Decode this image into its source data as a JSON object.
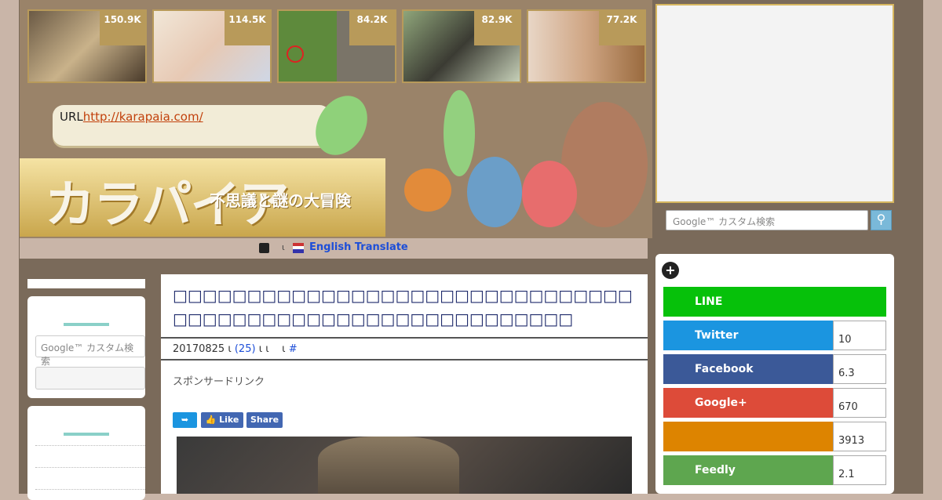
{
  "thumbs": [
    {
      "count": "150.9K",
      "name": "oysters"
    },
    {
      "count": "114.5K",
      "name": "snow-white-drawing"
    },
    {
      "count": "84.2K",
      "name": "grave"
    },
    {
      "count": "82.9K",
      "name": "cat-tree"
    },
    {
      "count": "77.2K",
      "name": "woman-tiger"
    }
  ],
  "url": {
    "label": "URL",
    "link": "http://karapaia.com/"
  },
  "logo": {
    "main": "カラパイア",
    "sub": "不思議と謎の大冒険"
  },
  "translate": {
    "label": "English Translate"
  },
  "search": {
    "placeholder": "Google™ カスタム検索",
    "button_icon": "search-icon"
  },
  "left_search": {
    "placeholder": "Google™ カスタム検索"
  },
  "article": {
    "title": "□□□□□□□□□□□□□□□□□□□□□□□□□□□□□□□□□□□□□□□□□□□□□□□□□□□□□□□□□□",
    "meta_date": "20170825",
    "meta_mark1": "ι",
    "meta_comments": "(25)",
    "meta_mark2": "ι ι",
    "meta_mark3": "ι",
    "meta_hash": "#",
    "sponsor": "スポンサードリンク",
    "buttons": {
      "tweet": "",
      "like": "Like",
      "share": "Share"
    }
  },
  "share": {
    "items": [
      {
        "label": "LINE",
        "count": "",
        "color": "#06c10a"
      },
      {
        "label": "Twitter",
        "count": "10",
        "color": "#1b95e0"
      },
      {
        "label": "Facebook",
        "count": "6.3",
        "color": "#3b5998"
      },
      {
        "label": "Google+",
        "count": "670",
        "color": "#dd4b39"
      },
      {
        "label": "",
        "count": "3913",
        "color": "#dd8400"
      },
      {
        "label": "Feedly",
        "count": "2.1",
        "color": "#5ea64f"
      }
    ]
  },
  "colors": {
    "accent": "#b89a5a",
    "link": "#1d4ed8",
    "title": "#1e2a6b"
  }
}
